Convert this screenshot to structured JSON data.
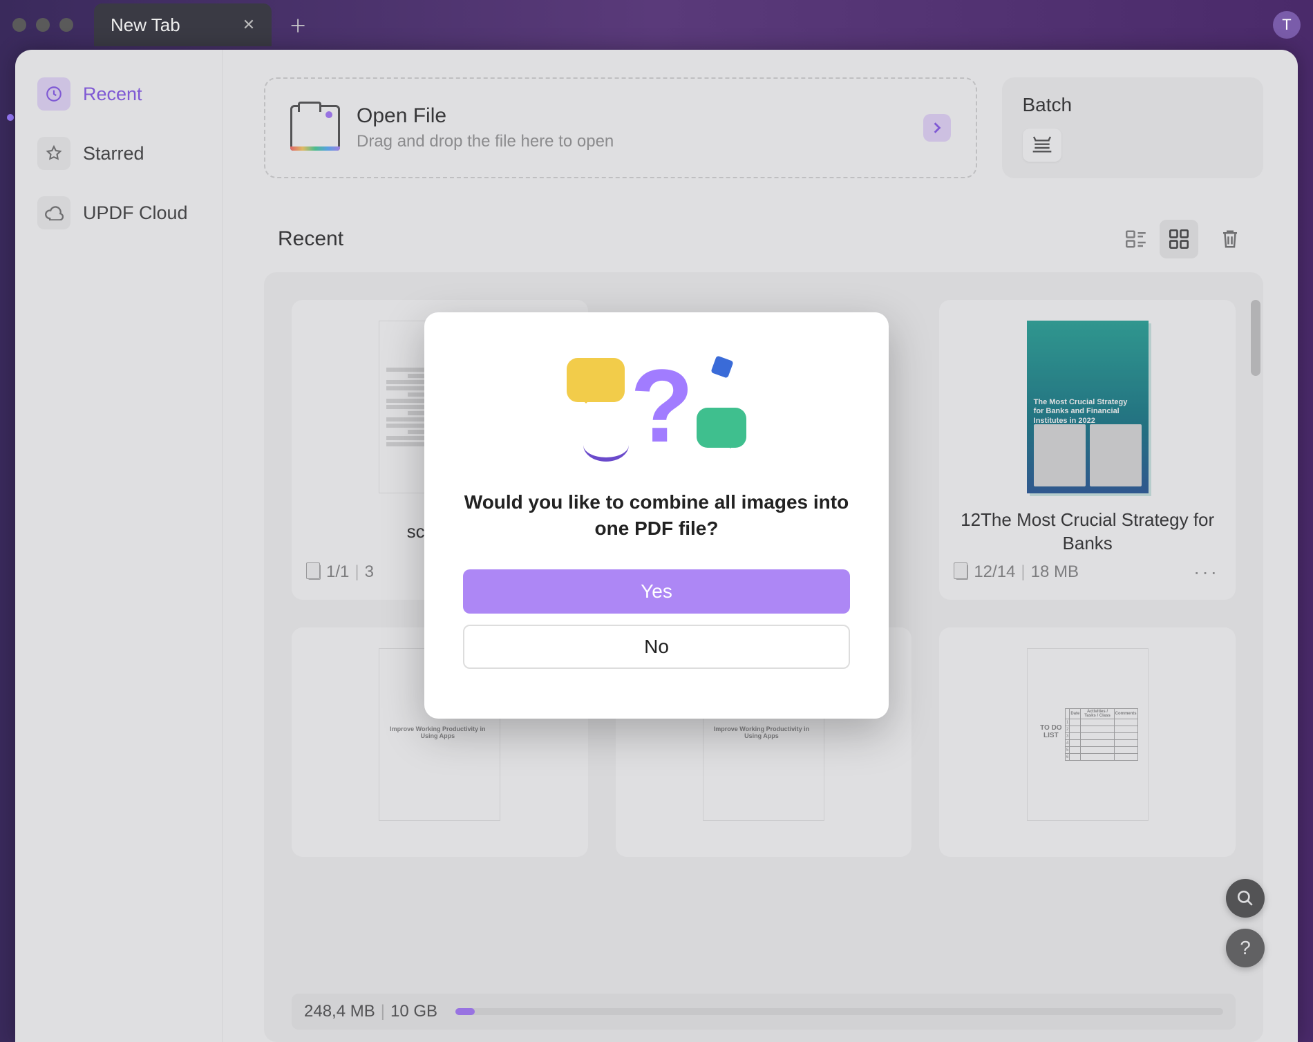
{
  "tab": {
    "title": "New Tab"
  },
  "avatar_letter": "T",
  "sidebar": {
    "items": [
      {
        "label": "Recent"
      },
      {
        "label": "Starred"
      },
      {
        "label": "UPDF Cloud"
      }
    ]
  },
  "open_file": {
    "title": "Open File",
    "subtitle": "Drag and drop the file here to open"
  },
  "batch": {
    "title": "Batch"
  },
  "recent": {
    "title": "Recent",
    "files": [
      {
        "name": "scann…",
        "pages": "1/1",
        "size_prefix": "3"
      },
      {
        "name": "12The Most Crucial Strategy for Banks",
        "pages": "12/14",
        "size": "18 MB"
      }
    ],
    "row2_thumbs": [
      {
        "kind": "doc",
        "heading": "Improve Working Productivity in Using Apps"
      },
      {
        "kind": "doc",
        "heading": "Improve Working Productivity in Using Apps"
      },
      {
        "kind": "todo",
        "heading": "TO DO LIST"
      }
    ]
  },
  "storage": {
    "used": "248,4 MB",
    "total": "10 GB"
  },
  "dialog": {
    "message": "Would you like to combine all images into one PDF file?",
    "yes": "Yes",
    "no": "No"
  }
}
